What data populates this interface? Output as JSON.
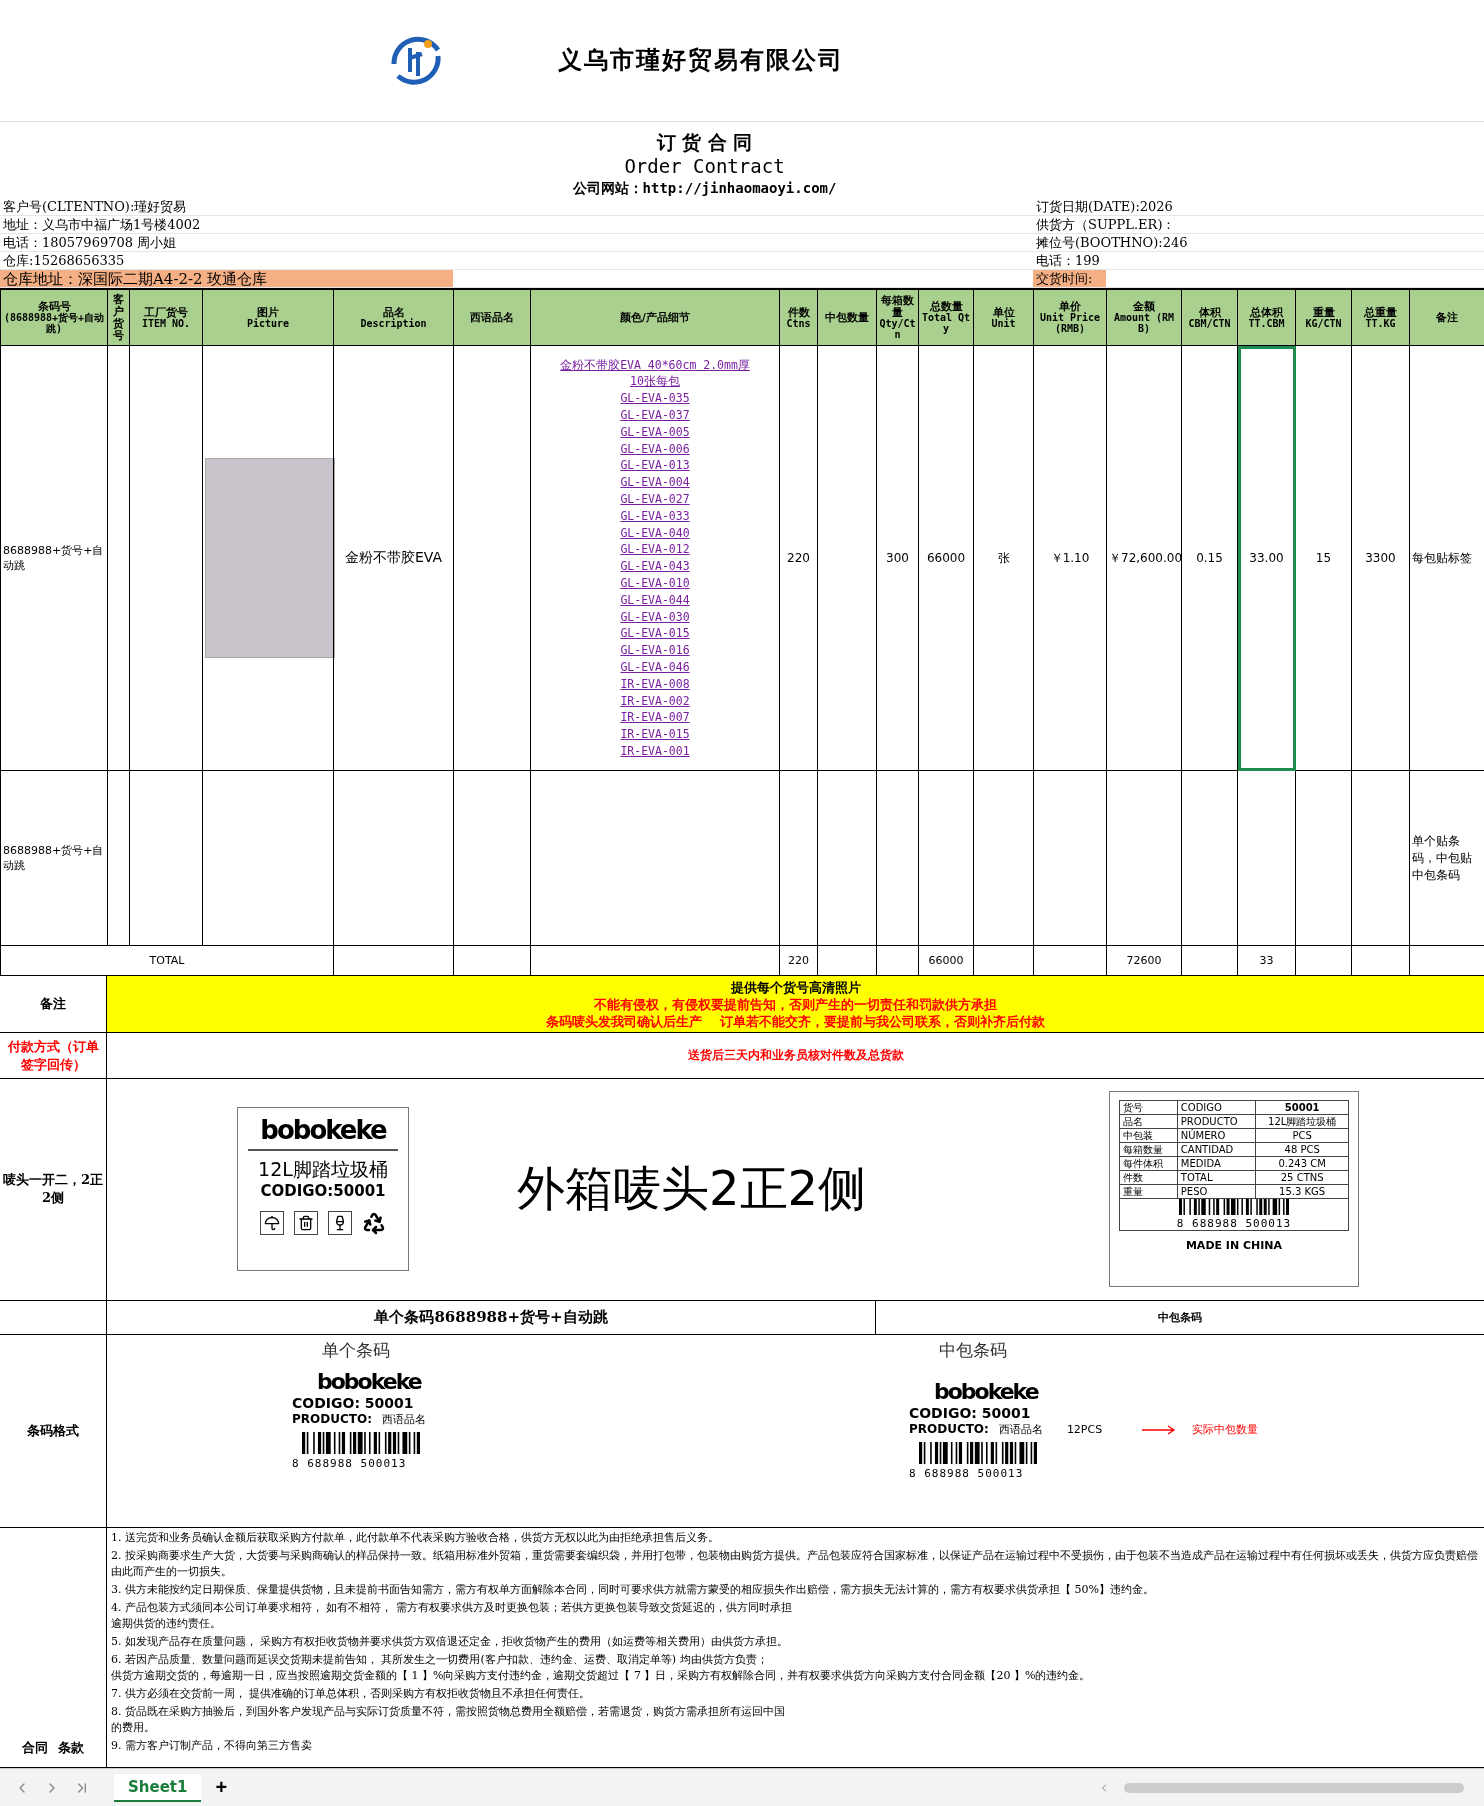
{
  "company": {
    "name": "义乌市瑾好贸易有限公司"
  },
  "title": {
    "chinese": "订 货 合 同",
    "english": "Order Contract",
    "website": "公司网站：http://jinhaomaoyi.com/"
  },
  "client_info": [
    "客户号(CLTENTNO):瑾好贸易",
    "地址：义乌市中福广场1号楼4002",
    "电话：18057969708 周小姐",
    "仓库:15268656335"
  ],
  "warehouse_address": "仓库地址：深国际二期A4-2-2 玫通仓库",
  "order_info": [
    "订货日期(DATE):2026",
    "供货方（SUPPL.ER)：",
    "摊位号(BOOTHNO):246",
    "电话：199"
  ],
  "delivery_time_label": "交货时间:",
  "table": {
    "columns": [
      {
        "zh": "条码号",
        "en": "(8688988+货号+自动跳)"
      },
      {
        "zh": "客户货号"
      },
      {
        "zh": "工厂货号",
        "en": "ITEM NO."
      },
      {
        "zh": "图片",
        "en": "Picture"
      },
      {
        "zh": "品名",
        "en": "Description"
      },
      {
        "zh": "西语品名"
      },
      {
        "zh": "颜色/产品细节"
      },
      {
        "zh": "件数",
        "en": "Ctns"
      },
      {
        "zh": "中包数量"
      },
      {
        "zh": "每箱数量",
        "en": "Qty/Ctn"
      },
      {
        "zh": "总数量",
        "en": "Total Qty"
      },
      {
        "zh": "单位",
        "en": "Unit"
      },
      {
        "zh": "单价",
        "en": "Unit Price (RMB)"
      },
      {
        "zh": "金额",
        "en": "Amount (RMB)"
      },
      {
        "zh": "体积",
        "en": "CBM/CTN"
      },
      {
        "zh": "总体积",
        "en": "TT.CBM"
      },
      {
        "zh": "重量",
        "en": "KG/CTN"
      },
      {
        "zh": "总重量",
        "en": "TT.KG"
      },
      {
        "zh": "备注"
      }
    ],
    "rows": [
      {
        "barcode": "8688988+货号+自动跳",
        "picture": {
          "kind": "photo"
        },
        "description": "金粉不带胶EVA",
        "details": {
          "headline": "金粉不带胶EVA 40*60cm 2.0mm厚 10张每包",
          "codes": [
            "GL-EVA-035",
            "GL-EVA-037",
            "GL-EVA-005",
            "GL-EVA-006",
            "GL-EVA-013",
            "GL-EVA-004",
            "GL-EVA-027",
            "GL-EVA-033",
            "GL-EVA-040",
            "GL-EVA-012",
            "GL-EVA-043",
            "GL-EVA-010",
            "GL-EVA-044",
            "GL-EVA-030",
            "GL-EVA-015",
            "GL-EVA-016",
            "GL-EVA-046",
            "IR-EVA-008",
            "IR-EVA-002",
            "IR-EVA-007",
            "IR-EVA-015",
            "IR-EVA-001"
          ]
        },
        "ctns": "220",
        "qty_per_ctn": "300",
        "total_qty": "66000",
        "unit": "张",
        "unit_price": "￥1.10",
        "amount": "￥72,600.00",
        "cbm": "0.15",
        "tt_cbm": "33.00",
        "kg": "15",
        "tt_kg": "3300",
        "remark": "每包贴标签",
        "tt_cbm_selected": true
      },
      {
        "barcode": "8688988+货号+自动跳",
        "remark": "单个贴条码，中包贴中包条码",
        "tt_cbm_selected": false
      }
    ],
    "total": {
      "label": "TOTAL",
      "ctns": "220",
      "total_qty": "66000",
      "amount": "72600",
      "tt_cbm": "33"
    }
  },
  "remarks": {
    "label": "备注",
    "lines": [
      {
        "text": "提供每个货号高清照片",
        "color": "#000000"
      },
      {
        "text": "不能有侵权，有侵权要提前告知，否则产生的一切责任和罚款供方承担",
        "color": "#ff0000"
      },
      {
        "text": "条码唛头发我司确认后生产    订单若不能交齐，要提前与我公司联系，否则补齐后付款",
        "color": "#ff0000"
      }
    ]
  },
  "payment": {
    "label": "付款方式（订单签字回传）",
    "value": "送货后三天内和业务员核对件数及总货款"
  },
  "shipping_marks": {
    "label": "唛头一开二，2正2侧",
    "front": {
      "brand": "bobokeke",
      "product": "12L脚踏垃圾桶",
      "code": "CODIGO:50001"
    },
    "caption": "外箱唛头2正2侧",
    "side": {
      "rows": [
        [
          "货号",
          "CODIGO",
          "50001"
        ],
        [
          "品名",
          "PRODUCTO",
          "12L脚踏垃圾桶"
        ],
        [
          "中包装",
          "NÚMERO",
          "PCS"
        ],
        [
          "每箱数量",
          "CANTIDAD",
          "48 PCS"
        ],
        [
          "每件体积",
          "MEDIDA",
          "0.243  CM"
        ],
        [
          "件数",
          "TOTAL",
          "25  CTNS"
        ],
        [
          "重量",
          "PESO",
          "15.3  KGS"
        ]
      ],
      "barcode_number": "8 688988 500013",
      "origin": "MADE IN CHINA"
    }
  },
  "barcode_headings": [
    "单个条码8688988+货号+自动跳",
    "中包条码"
  ],
  "barcode_format": {
    "label": "条码格式",
    "single": {
      "title": "单个条码",
      "brand": "bobokeke",
      "code": "CODIGO: 50001",
      "product_label": "PRODUCTO:",
      "product": "西语品名",
      "barcode_number": "8 688988 500013"
    },
    "inner": {
      "title": "中包条码",
      "brand": "bobokeke",
      "code": "CODIGO: 50001",
      "product_label": "PRODUCTO:",
      "product": "西语品名",
      "count": "12PCS",
      "note": "实际中包数量",
      "barcode_number": "8 688988 500013"
    }
  },
  "terms": {
    "label": "合同  条款",
    "items": [
      [
        "1. 送完货和业务员确认金额后获取采购方付款单，此付款单不代表采购方验收合格，供货方无权以此为由拒绝承担售后义务。"
      ],
      [
        "2. 按采购商要求生产大货，大货要与采购商确认的样品保持一致。纸箱用标准外贸箱，重货需要套编织袋，并用打包带，包装物由购货方提供。产品包装应符合国家标准，以保证产品在运输过程中不受损伤，由于包装不当造成产品在运输过程中有任何损坏或丢失，供货方应负责赔偿由此而产生的一切损失。"
      ],
      [
        "3. 供方未能按约定日期保质、保量提供货物，且未提前书面告知需方，需方有权单方面解除本合同，同时可要求供方就需方蒙受的相应损失作出赔偿，需方损失无法计算的，需方有权要求供货承担【  50%】违约金。"
      ],
      [
        "4. 产品包装方式须同本公司订单要求相符， 如有不相符， 需方有权要求供方及时更换包装；若供方更换包装导致交货延迟的，供方同时承担",
        "逾期供货的违约责任。"
      ],
      [
        "5. 如发现产品存在质量问题， 采购方有权拒收货物并要求供货方双倍退还定金，拒收货物产生的费用（如运费等相关费用）由供货方承担。"
      ],
      [
        "6. 若因产品质量、数量问题而延误交货期未提前告知， 其所发生之一切费用(客户扣款、违约金、运费、取消定单等) 均由供货方负责；",
        "供货方逾期交货的，每逾期一日，应当按照逾期交货金额的【 1 】%向采购方支付违约金，逾期交货超过【 7 】日，采购方有权解除合同，并有权要求供货方向采购方支付合同金额【20 】%的违约金。"
      ],
      [
        "7. 供方必须在交货前一周， 提供准确的订单总体积，否则采购方有权拒收货物且不承担任何责任。"
      ],
      [
        "8. 货品既在采购方抽验后，到国外客户发现产品与实际订货质量不符，需按照货物总费用全额赔偿，若需退货，购货方需承担所有运回中国",
        "的费用。"
      ],
      [
        "9. 需方客户订制产品，不得向第三方售卖"
      ]
    ]
  },
  "sheet_tabs": [
    {
      "label": "Sheet1",
      "selected": true
    }
  ],
  "add_sheet": "+"
}
